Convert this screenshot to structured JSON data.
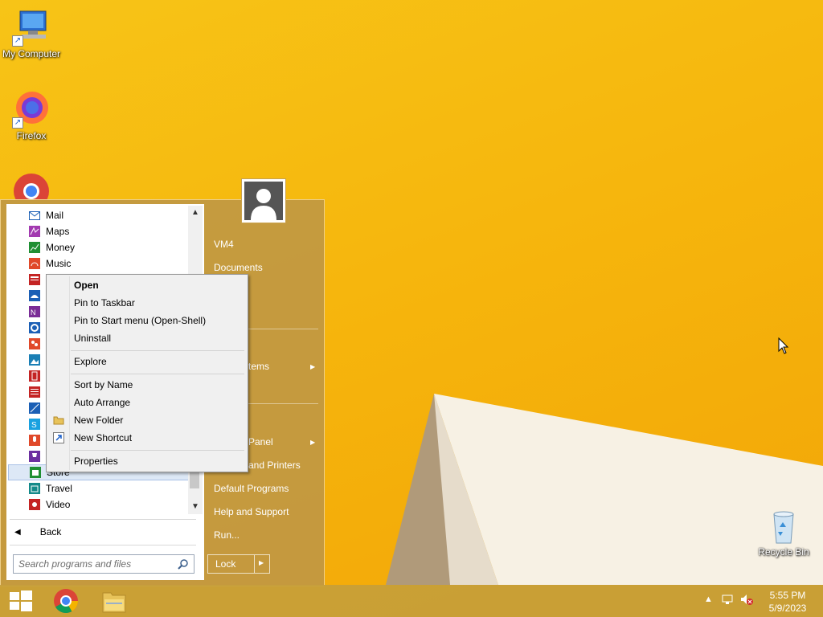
{
  "desktop": {
    "icons": [
      {
        "label": "My Computer",
        "icon": "computer-icon"
      },
      {
        "label": "Firefox",
        "icon": "firefox-icon"
      },
      {
        "label": "",
        "icon": "chrome-icon"
      },
      {
        "label": "Recycle Bin",
        "icon": "recycle-bin-icon"
      }
    ]
  },
  "start_menu": {
    "programs": [
      {
        "label": "Mail",
        "icon": "mail-icon",
        "color": "#1b5fb5"
      },
      {
        "label": "Maps",
        "icon": "maps-icon",
        "color": "#a23ab0"
      },
      {
        "label": "Money",
        "icon": "money-icon",
        "color": "#1f8f33"
      },
      {
        "label": "Music",
        "icon": "music-icon",
        "color": "#e0492a"
      },
      {
        "label": "",
        "icon": "news-icon",
        "color": "#c42424"
      },
      {
        "label": "",
        "icon": "onedrive-icon",
        "color": "#1b5fb5"
      },
      {
        "label": "",
        "icon": "onenote-icon",
        "color": "#7a2c97"
      },
      {
        "label": "",
        "icon": "pc-settings-icon",
        "color": "#1b5fb5"
      },
      {
        "label": "",
        "icon": "people-icon",
        "color": "#e0492a"
      },
      {
        "label": "",
        "icon": "photos-icon",
        "color": "#1b7fb5"
      },
      {
        "label": "",
        "icon": "reading-list-icon",
        "color": "#c42424"
      },
      {
        "label": "",
        "icon": "reader-icon",
        "color": "#c42424"
      },
      {
        "label": "",
        "icon": "scan-icon",
        "color": "#1b5fb5"
      },
      {
        "label": "",
        "icon": "skype-icon",
        "color": "#1aa1e0"
      },
      {
        "label": "",
        "icon": "sound-recorder-icon",
        "color": "#e0492a"
      },
      {
        "label": "",
        "icon": "sports-icon",
        "color": "#6b2fa0"
      },
      {
        "label": "Store",
        "icon": "store-icon",
        "color": "#1f8f33"
      },
      {
        "label": "Travel",
        "icon": "travel-icon",
        "color": "#148a8a"
      },
      {
        "label": "Video",
        "icon": "video-icon",
        "color": "#c42424"
      }
    ],
    "back_label": "Back",
    "search_placeholder": "Search programs and files",
    "user_name": "VM4",
    "right_items": {
      "documents": "Documents",
      "items": "tems",
      "control_panel": "Panel",
      "devices": "and Printers",
      "default_programs": "Default Programs",
      "help": "Help and Support",
      "run": "Run..."
    },
    "lock_label": "Lock"
  },
  "context_menu": {
    "open": "Open",
    "pin_taskbar": "Pin to Taskbar",
    "pin_start": "Pin to Start menu (Open-Shell)",
    "uninstall": "Uninstall",
    "explore": "Explore",
    "sort_by_name": "Sort by Name",
    "auto_arrange": "Auto Arrange",
    "new_folder": "New Folder",
    "new_shortcut": "New Shortcut",
    "properties": "Properties"
  },
  "taskbar": {
    "clock_time": "5:55 PM",
    "clock_date": "5/9/2023"
  },
  "colors": {
    "accent": "#c69e3a",
    "wallpaper": "#f6b60d"
  }
}
